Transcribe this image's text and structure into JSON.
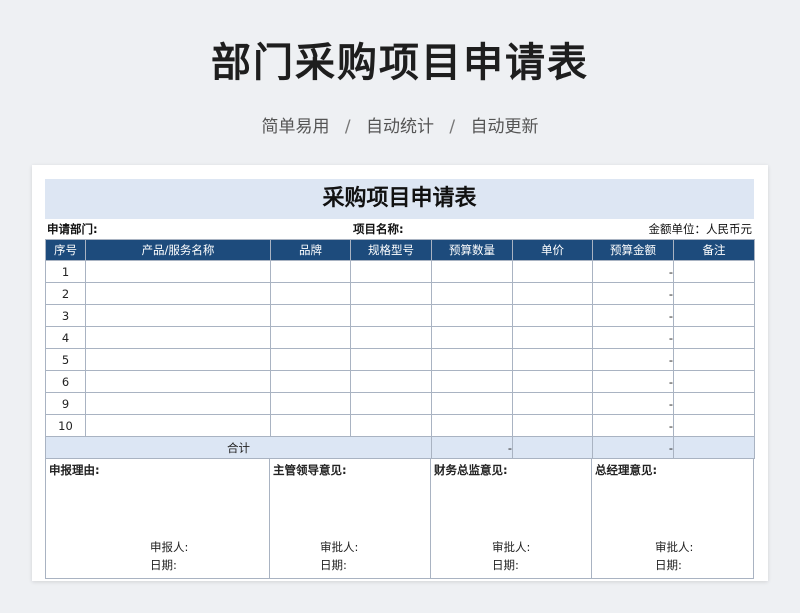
{
  "page": {
    "title": "部门采购项目申请表",
    "subtitle_parts": [
      "简单易用",
      "自动统计",
      "自动更新"
    ],
    "separator": "/"
  },
  "form": {
    "title": "采购项目申请表",
    "dept_label": "申请部门:",
    "project_label": "项目名称:",
    "unit_label": "金额单位：人民币元",
    "headers": [
      "序号",
      "产品/服务名称",
      "品牌",
      "规格型号",
      "预算数量",
      "单价",
      "预算金额",
      "备注"
    ],
    "rows": [
      {
        "no": "1",
        "amount": "-"
      },
      {
        "no": "2",
        "amount": "-"
      },
      {
        "no": "3",
        "amount": "-"
      },
      {
        "no": "4",
        "amount": "-"
      },
      {
        "no": "5",
        "amount": "-"
      },
      {
        "no": "6",
        "amount": "-"
      },
      {
        "no": "9",
        "amount": "-"
      },
      {
        "no": "10",
        "amount": "-"
      }
    ],
    "total": {
      "label": "合计",
      "qty": "-",
      "amount": "-"
    },
    "signoff": [
      {
        "opinion": "申报理由:",
        "signer": "申报人:",
        "date": "日期:"
      },
      {
        "opinion": "主管领导意见:",
        "signer": "审批人:",
        "date": "日期:"
      },
      {
        "opinion": "财务总监意见:",
        "signer": "审批人:",
        "date": "日期:"
      },
      {
        "opinion": "总经理意见:",
        "signer": "审批人:",
        "date": "日期:"
      }
    ]
  },
  "colors": {
    "header_bg": "#1d4b7c",
    "title_band": "#dde6f3",
    "total_row": "#dce6f4",
    "background": "#eef0f3"
  }
}
